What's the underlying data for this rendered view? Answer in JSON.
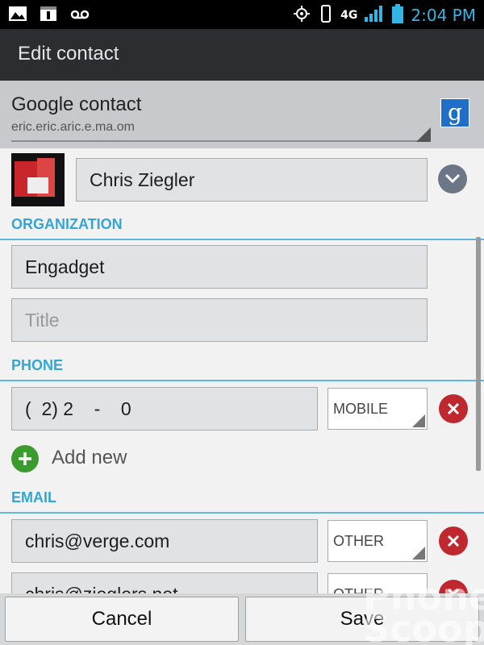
{
  "status_bar": {
    "network": "4G",
    "time": "2:04 PM"
  },
  "action_bar": {
    "title": "Edit contact"
  },
  "account": {
    "title": "Google contact",
    "email": "eric.eric.aric.e.ma.om",
    "icon": "g"
  },
  "contact": {
    "name": "Chris Ziegler"
  },
  "organization": {
    "header": "ORGANIZATION",
    "company": "Engadget",
    "title_placeholder": "Title"
  },
  "phone": {
    "header": "PHONE",
    "number": "(  2) 2    -    0",
    "type": "MOBILE",
    "add_new": "Add new"
  },
  "email": {
    "header": "EMAIL",
    "entries": [
      {
        "value": "chris@verge.com",
        "type": "OTHER"
      },
      {
        "value": "chris@zieglers.net",
        "type": "OTHER"
      }
    ]
  },
  "buttons": {
    "cancel": "Cancel",
    "save": "Save"
  },
  "colors": {
    "accent": "#33a6d6",
    "remove": "#c0282f",
    "add": "#3a9c2c",
    "actionbar": "#2c2d30"
  },
  "watermark": "Phone Scoop"
}
